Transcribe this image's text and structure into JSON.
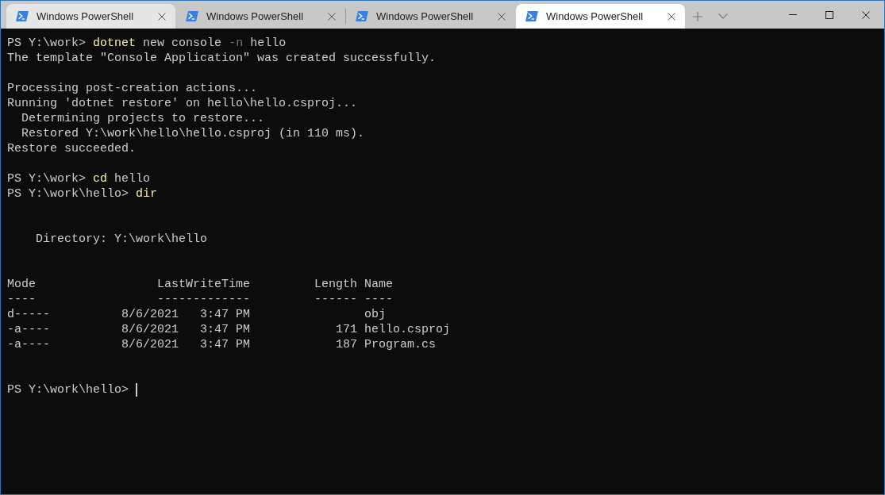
{
  "tabs": [
    {
      "title": "Windows PowerShell",
      "selected": false,
      "hovered": true
    },
    {
      "title": "Windows PowerShell",
      "selected": false,
      "hovered": false
    },
    {
      "title": "Windows PowerShell",
      "selected": false,
      "hovered": false
    },
    {
      "title": "Windows PowerShell",
      "selected": true,
      "hovered": false
    }
  ],
  "terminal": {
    "lines": [
      {
        "kind": "command",
        "prompt": "PS Y:\\work>",
        "cursor": false,
        "parts": [
          {
            "kind": "command",
            "text": "dotnet"
          },
          {
            "kind": "argument",
            "text": "new console"
          },
          {
            "kind": "parameter",
            "text": "-n"
          },
          {
            "kind": "argument",
            "text": "hello"
          }
        ]
      },
      {
        "kind": "output",
        "text": "The template \"Console Application\" was created successfully."
      },
      {
        "kind": "blank"
      },
      {
        "kind": "output",
        "text": "Processing post-creation actions..."
      },
      {
        "kind": "output",
        "text": "Running 'dotnet restore' on hello\\hello.csproj...",
        "children": [
          {
            "kind": "output",
            "text": "Determining projects to restore..."
          },
          {
            "kind": "output",
            "text": "Restored Y:\\work\\hello\\hello.csproj (in 110 ms)."
          }
        ]
      },
      {
        "kind": "output",
        "text": "Restore succeeded."
      },
      {
        "kind": "blank"
      },
      {
        "kind": "command",
        "prompt": "PS Y:\\work>",
        "cursor": false,
        "parts": [
          {
            "kind": "command",
            "text": "cd"
          },
          {
            "kind": "argument",
            "text": "hello"
          }
        ]
      },
      {
        "kind": "command",
        "prompt": "PS Y:\\work\\hello>",
        "cursor": false,
        "parts": [
          {
            "kind": "command",
            "text": "dir"
          }
        ]
      },
      {
        "kind": "blank"
      },
      {
        "kind": "blank"
      },
      {
        "kind": "heading",
        "text": "Directory: Y:\\work\\hello"
      },
      {
        "kind": "blank"
      },
      {
        "kind": "blank"
      },
      {
        "kind": "table",
        "columns": [
          {
            "label": "Mode",
            "rule": "----"
          },
          {
            "label": "LastWriteTime",
            "rule": "-------------"
          },
          {
            "label": "Length",
            "rule": "------"
          },
          {
            "label": "Name",
            "rule": "----"
          }
        ],
        "rows": [
          {
            "mode": "d-----",
            "last_write_time": "8/6/2021   3:47 PM",
            "name": "obj"
          },
          {
            "mode": "-a----",
            "last_write_time": "8/6/2021   3:47 PM",
            "length": "171",
            "name": "hello.csproj"
          },
          {
            "mode": "-a----",
            "last_write_time": "8/6/2021   3:47 PM",
            "length": "187",
            "name": "Program.cs"
          }
        ]
      },
      {
        "kind": "blank"
      },
      {
        "kind": "blank"
      },
      {
        "kind": "command",
        "prompt": "PS Y:\\work\\hello>",
        "cursor": true
      }
    ]
  }
}
